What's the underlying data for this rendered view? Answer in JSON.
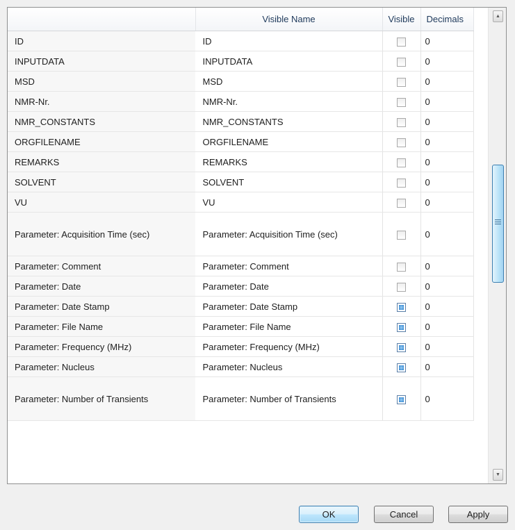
{
  "columns": {
    "name": "",
    "visible_name": "Visible Name",
    "visible": "Visible",
    "decimals": "Decimals"
  },
  "rows": [
    {
      "name": "ID",
      "visible_name": "ID",
      "visible": false,
      "decimals": "0",
      "tall": false
    },
    {
      "name": "INPUTDATA",
      "visible_name": "INPUTDATA",
      "visible": false,
      "decimals": "0",
      "tall": false
    },
    {
      "name": "MSD",
      "visible_name": "MSD",
      "visible": false,
      "decimals": "0",
      "tall": false
    },
    {
      "name": "NMR-Nr.",
      "visible_name": "NMR-Nr.",
      "visible": false,
      "decimals": "0",
      "tall": false
    },
    {
      "name": "NMR_CONSTANTS",
      "visible_name": "NMR_CONSTANTS",
      "visible": false,
      "decimals": "0",
      "tall": false
    },
    {
      "name": "ORGFILENAME",
      "visible_name": "ORGFILENAME",
      "visible": false,
      "decimals": "0",
      "tall": false
    },
    {
      "name": "REMARKS",
      "visible_name": "REMARKS",
      "visible": false,
      "decimals": "0",
      "tall": false
    },
    {
      "name": "SOLVENT",
      "visible_name": "SOLVENT",
      "visible": false,
      "decimals": "0",
      "tall": false
    },
    {
      "name": "VU",
      "visible_name": "VU",
      "visible": false,
      "decimals": "0",
      "tall": false
    },
    {
      "name": "Parameter: Acquisition Time (sec)",
      "visible_name": "Parameter: Acquisition Time (sec)",
      "visible": false,
      "decimals": "0",
      "tall": true
    },
    {
      "name": "Parameter: Comment",
      "visible_name": "Parameter: Comment",
      "visible": false,
      "decimals": "0",
      "tall": false
    },
    {
      "name": "Parameter: Date",
      "visible_name": "Parameter: Date",
      "visible": false,
      "decimals": "0",
      "tall": false
    },
    {
      "name": "Parameter: Date Stamp",
      "visible_name": "Parameter: Date Stamp",
      "visible": true,
      "decimals": "0",
      "tall": false
    },
    {
      "name": "Parameter: File Name",
      "visible_name": "Parameter: File Name",
      "visible": true,
      "decimals": "0",
      "tall": false
    },
    {
      "name": "Parameter: Frequency (MHz)",
      "visible_name": "Parameter: Frequency (MHz)",
      "visible": true,
      "decimals": "0",
      "tall": false
    },
    {
      "name": "Parameter: Nucleus",
      "visible_name": "Parameter: Nucleus",
      "visible": true,
      "decimals": "0",
      "tall": false
    },
    {
      "name": "Parameter: Number of Transients",
      "visible_name": "Parameter: Number of Transients",
      "visible": true,
      "decimals": "0",
      "tall": true
    }
  ],
  "scrollbar": {
    "up_icon": "arrow-up-icon",
    "down_icon": "arrow-down-icon",
    "grip_icon": "grip-icon"
  },
  "buttons": {
    "ok": "OK",
    "cancel": "Cancel",
    "apply": "Apply"
  },
  "colors": {
    "checked": "#2f7fc8",
    "default_button_border": "#3c7fb1"
  }
}
